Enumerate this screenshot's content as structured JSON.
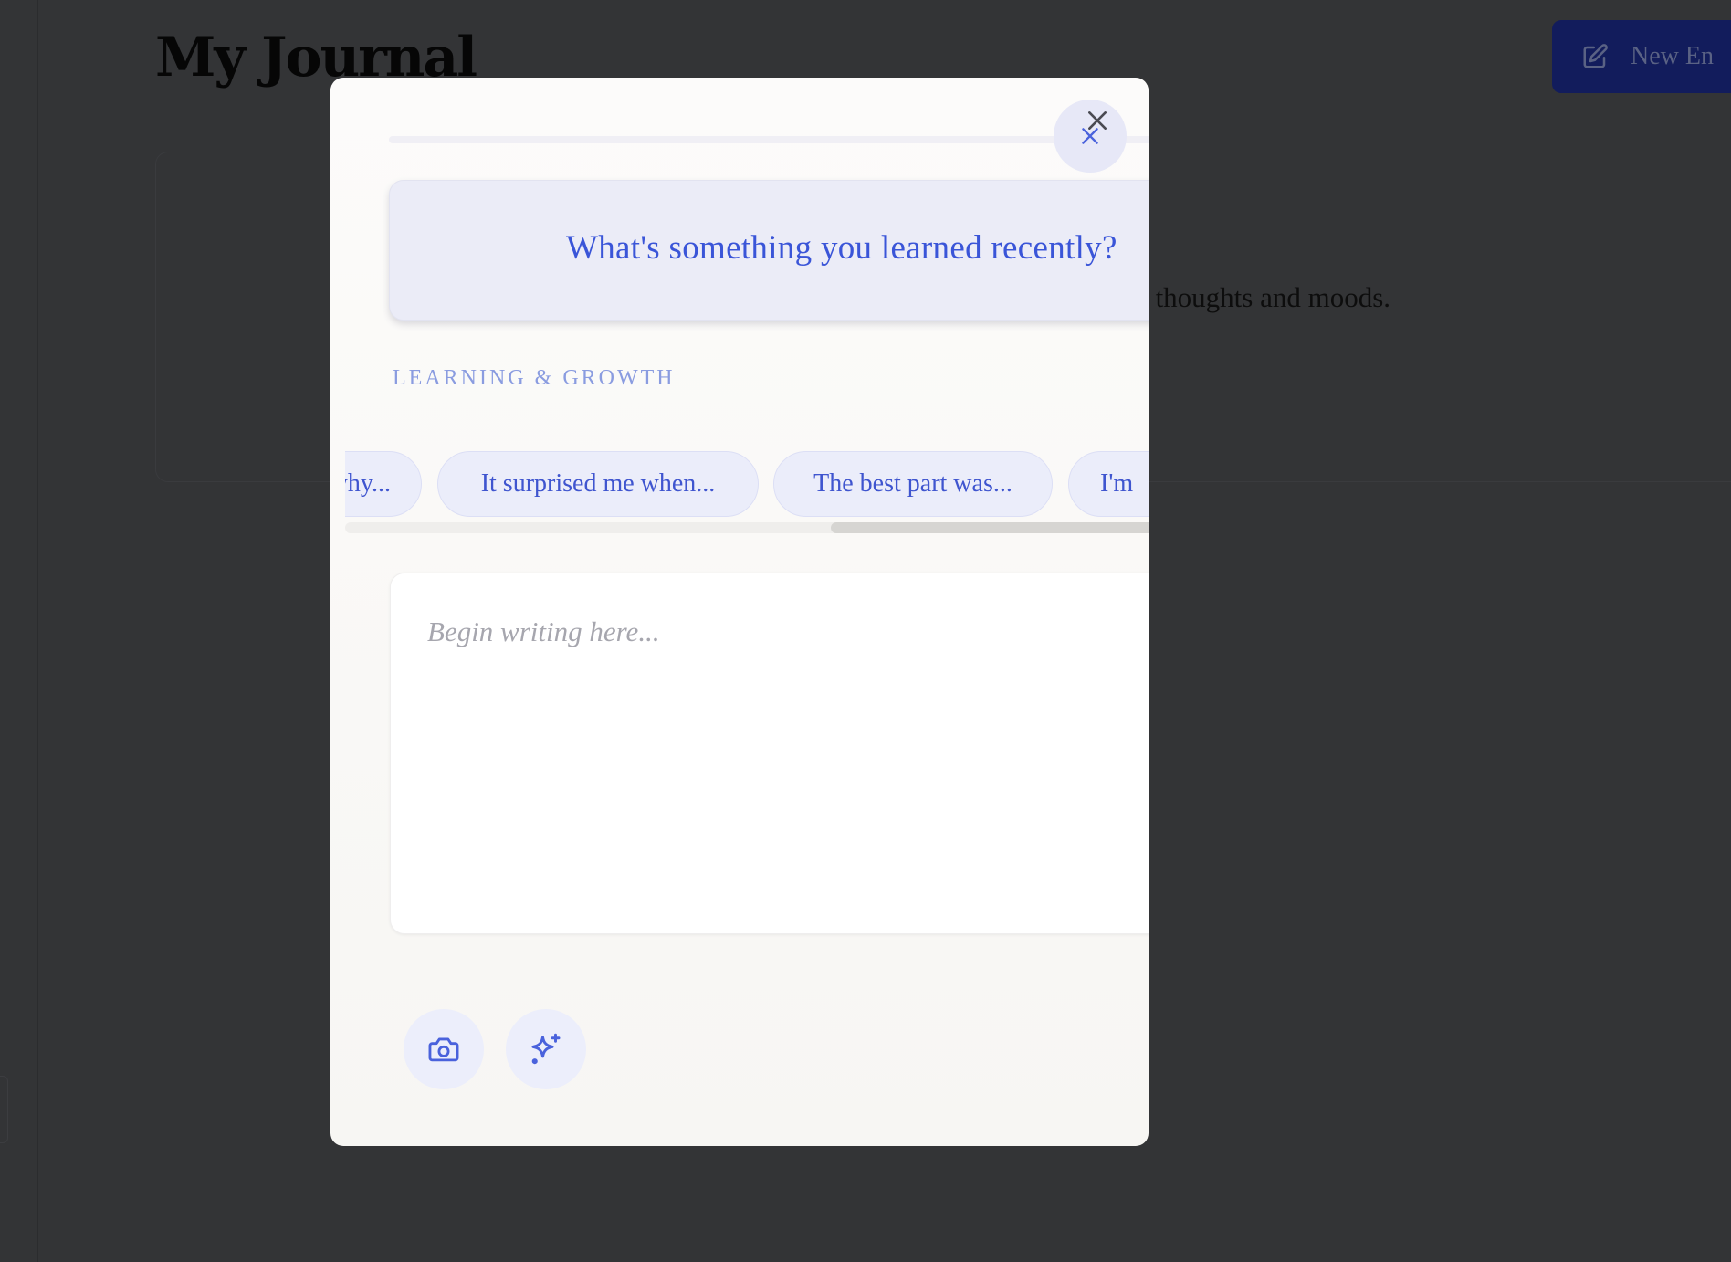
{
  "page": {
    "title": "My Journal",
    "new_entry_label": "New En",
    "empty_card_text": "ur thoughts and moods."
  },
  "modal": {
    "prompt": "What's something you learned recently?",
    "category": "LEARNING & GROWTH",
    "suggestions": [
      "why...",
      "It surprised me when...",
      "The best part was...",
      "I'm"
    ],
    "editor_placeholder": "Begin writing here...",
    "tools": [
      {
        "name": "camera",
        "icon": "camera-icon"
      },
      {
        "name": "ai",
        "icon": "sparkles-icon"
      }
    ]
  },
  "colors": {
    "accent": "#3a55d8",
    "chip_background": "#ebedfa",
    "overlay": "#333436",
    "new_entry_button": "#121c5c"
  }
}
